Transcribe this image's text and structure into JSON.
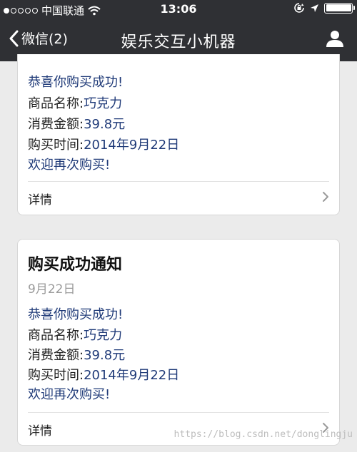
{
  "status_bar": {
    "carrier": "中国联通",
    "time": "13:06",
    "icons": [
      "signal-dots-icon",
      "wifi-icon",
      "orientation-lock-icon",
      "location-arrow-icon",
      "battery-icon"
    ],
    "battery_level": 1.0
  },
  "nav": {
    "back_label": "微信(2)",
    "title": "娱乐交互小机器",
    "icons": [
      "chevron-left-icon",
      "profile-icon"
    ]
  },
  "cards": [
    {
      "greeting": "恭喜你购买成功!",
      "product_label": "商品名称:",
      "product_value": "巧克力",
      "amount_label": "消费金额:",
      "amount_value": "39.8元",
      "time_label": "购买时间:",
      "time_value": "2014年9月22日",
      "closing": "欢迎再次购买!",
      "detail_label": "详情"
    },
    {
      "title": "购买成功通知",
      "date": "9月22日",
      "greeting": "恭喜你购买成功!",
      "product_label": "商品名称:",
      "product_value": "巧克力",
      "amount_label": "消费金额:",
      "amount_value": "39.8元",
      "time_label": "购买时间:",
      "time_value": "2014年9月22日",
      "closing": "欢迎再次购买!",
      "detail_label": "详情"
    }
  ],
  "watermark": "https://blog.csdn.net/donglingju",
  "colors": {
    "bar_bg": "#2f3034",
    "page_bg": "#ebebeb",
    "value_blue": "#1f3a78"
  }
}
